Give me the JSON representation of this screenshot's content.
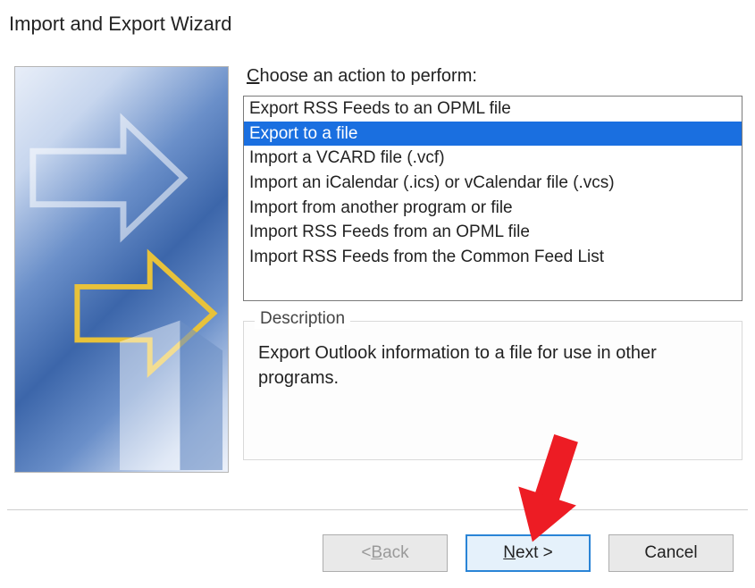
{
  "title": "Import and Export Wizard",
  "choose_label_pre": "C",
  "choose_label_rest": "hoose an action to perform:",
  "actions": {
    "selected_index": 1,
    "items": [
      "Export RSS Feeds to an OPML file",
      "Export to a file",
      "Import a VCARD file (.vcf)",
      "Import an iCalendar (.ics) or vCalendar file (.vcs)",
      "Import from another program or file",
      "Import RSS Feeds from an OPML file",
      "Import RSS Feeds from the Common Feed List"
    ]
  },
  "description": {
    "legend": "Description",
    "text": "Export Outlook information to a file for use in other programs."
  },
  "buttons": {
    "back_pre": "< ",
    "back_accel": "B",
    "back_rest": "ack",
    "next_accel": "N",
    "next_rest": "ext >",
    "cancel": "Cancel"
  }
}
